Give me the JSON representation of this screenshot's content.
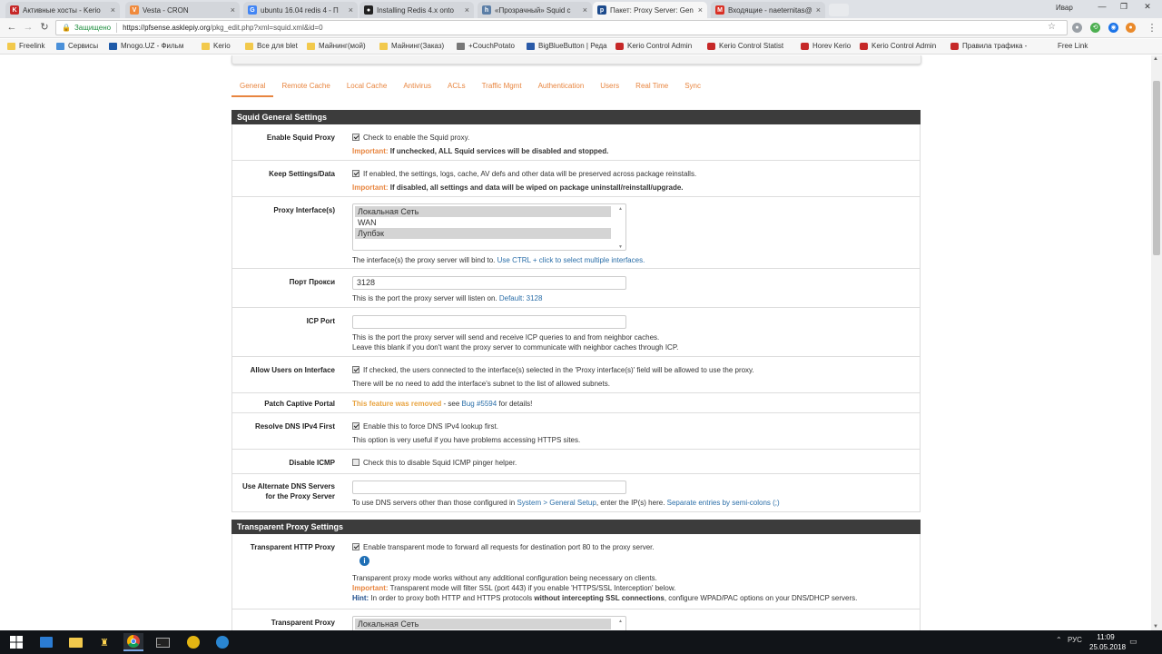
{
  "browser": {
    "tabs": [
      {
        "title": "Активные хосты - Kerio",
        "icon_color": "#c62828",
        "icon_glyph": "K"
      },
      {
        "title": "Vesta - CRON",
        "icon_color": "#f08a3c",
        "icon_glyph": "V"
      },
      {
        "title": "ubuntu 16.04 redis 4 - П",
        "icon_color": "#4285f4",
        "icon_glyph": "G"
      },
      {
        "title": "Installing Redis 4.x onto",
        "icon_color": "#222222",
        "icon_glyph": "●"
      },
      {
        "title": "«Прозрачный» Squid с",
        "icon_color": "#5b7ea6",
        "icon_glyph": "h"
      },
      {
        "title": "Пакет: Proxy Server: Gen",
        "icon_color": "#1c4a8c",
        "icon_glyph": "p"
      },
      {
        "title": "Входящие - naeternitas@",
        "icon_color": "#d93025",
        "icon_glyph": "M"
      }
    ],
    "active_tab": 5,
    "user_label": "Ивар",
    "secure_label": "Защищено",
    "url_host": "https://pfsense.asklepiy.org",
    "url_path": "/pkg_edit.php?xml=squid.xml&id=0",
    "bookmarks": [
      {
        "label": "Freelink",
        "icon": "folder-icon"
      },
      {
        "label": "Сервисы",
        "icon": "apps-icon"
      },
      {
        "label": "Mnogo.UZ - Фильм",
        "icon": "site-icon"
      },
      {
        "label": "Kerio",
        "icon": "folder-icon"
      },
      {
        "label": "Все для blet",
        "icon": "folder-icon"
      },
      {
        "label": "Майнинг(мой)",
        "icon": "folder-icon"
      },
      {
        "label": "Майнинг(Заказ)",
        "icon": "folder-icon"
      },
      {
        "label": "+CouchPotato",
        "icon": "page-icon"
      },
      {
        "label": "BigBlueButton | Реда",
        "icon": "tx-icon"
      },
      {
        "label": "Kerio Control Admin",
        "icon": "kerio-icon"
      },
      {
        "label": "Kerio Control Statist",
        "icon": "kerio-icon"
      },
      {
        "label": "Horev Kerio",
        "icon": "kerio-icon"
      },
      {
        "label": "Kerio Control Admin",
        "icon": "kerio-icon"
      },
      {
        "label": "Правила трафика -",
        "icon": "kerio-icon"
      },
      {
        "label": "Free Link",
        "icon": "none"
      }
    ]
  },
  "page": {
    "tabs": [
      "General",
      "Remote Cache",
      "Local Cache",
      "Antivirus",
      "ACLs",
      "Traffic Mgmt",
      "Authentication",
      "Users",
      "Real Time",
      "Sync"
    ],
    "active_tab": 0,
    "squid_general": {
      "header": "Squid General Settings",
      "enable_proxy": {
        "label": "Enable Squid Proxy",
        "checked": true,
        "desc": "Check to enable the Squid proxy.",
        "imp_label": "Important:",
        "imp_text": "If unchecked, ALL Squid services will be disabled and stopped."
      },
      "keep_settings": {
        "label": "Keep Settings/Data",
        "checked": true,
        "desc": "If enabled, the settings, logs, cache, AV defs and other data will be preserved across package reinstalls.",
        "imp_label": "Important:",
        "imp_text": "If disabled, all settings and data will be wiped on package uninstall/reinstall/upgrade."
      },
      "proxy_interfaces": {
        "label": "Proxy Interface(s)",
        "options": [
          {
            "text": "Локальная Сеть",
            "selected": true
          },
          {
            "text": "WAN",
            "selected": false
          },
          {
            "text": "Лупбэк",
            "selected": true
          }
        ],
        "help_prefix": "The interface(s) the proxy server will bind to.",
        "help_link": "Use CTRL + click to select multiple interfaces."
      },
      "proxy_port": {
        "label": "Порт Прокси",
        "value": "3128",
        "help": "This is the port the proxy server will listen on.",
        "help_link": "Default: 3128"
      },
      "icp_port": {
        "label": "ICP Port",
        "value": "",
        "help1": "This is the port the proxy server will send and receive ICP queries to and from neighbor caches.",
        "help2": "Leave this blank if you don't want the proxy server to communicate with neighbor caches through ICP."
      },
      "allow_users": {
        "label": "Allow Users on Interface",
        "checked": true,
        "desc": "If checked, the users connected to the interface(s) selected in the 'Proxy interface(s)' field will be allowed to use the proxy.",
        "help": "There will be no need to add the interface's subnet to the list of allowed subnets."
      },
      "captive_portal": {
        "label": "Patch Captive Portal",
        "removed": "This feature was removed",
        "mid": " - see ",
        "link": "Bug #5594",
        "suffix": " for details!"
      },
      "dns_ipv4": {
        "label": "Resolve DNS IPv4 First",
        "checked": true,
        "desc": "Enable this to force DNS IPv4 lookup first.",
        "help": "This option is very useful if you have problems accessing HTTPS sites."
      },
      "disable_icmp": {
        "label": "Disable ICMP",
        "checked": false,
        "desc": "Check this to disable Squid ICMP pinger helper."
      },
      "alt_dns": {
        "label1": "Use Alternate DNS Servers",
        "label2": "for the Proxy Server",
        "value": "",
        "help_a": "To use DNS servers other than those configured in ",
        "help_link1": "System > General Setup",
        "help_b": ", enter the IP(s) here. ",
        "help_link2": "Separate entries by semi-colons (;)"
      }
    },
    "transparent": {
      "header": "Transparent Proxy Settings",
      "http_proxy": {
        "label": "Transparent HTTP Proxy",
        "checked": true,
        "desc": "Enable transparent mode to forward all requests for destination port 80 to the proxy server.",
        "line1": "Transparent proxy mode works without any additional configuration being necessary on clients.",
        "imp_label": "Important:",
        "imp_text": "Transparent mode will filter SSL (port 443) if you enable 'HTTPS/SSL Interception' below.",
        "hint_label": "Hint:",
        "hint_a": "In order to proxy both HTTP and HTTPS protocols ",
        "hint_bold": "without intercepting SSL connections",
        "hint_b": ", configure WPAD/PAC options on your DNS/DHCP servers."
      },
      "proxy_iface": {
        "label": "Transparent Proxy",
        "first_option": "Локальная Сеть"
      }
    }
  },
  "taskbar": {
    "lang": "РУС",
    "time": "11:09",
    "date": "25.05.2018"
  }
}
